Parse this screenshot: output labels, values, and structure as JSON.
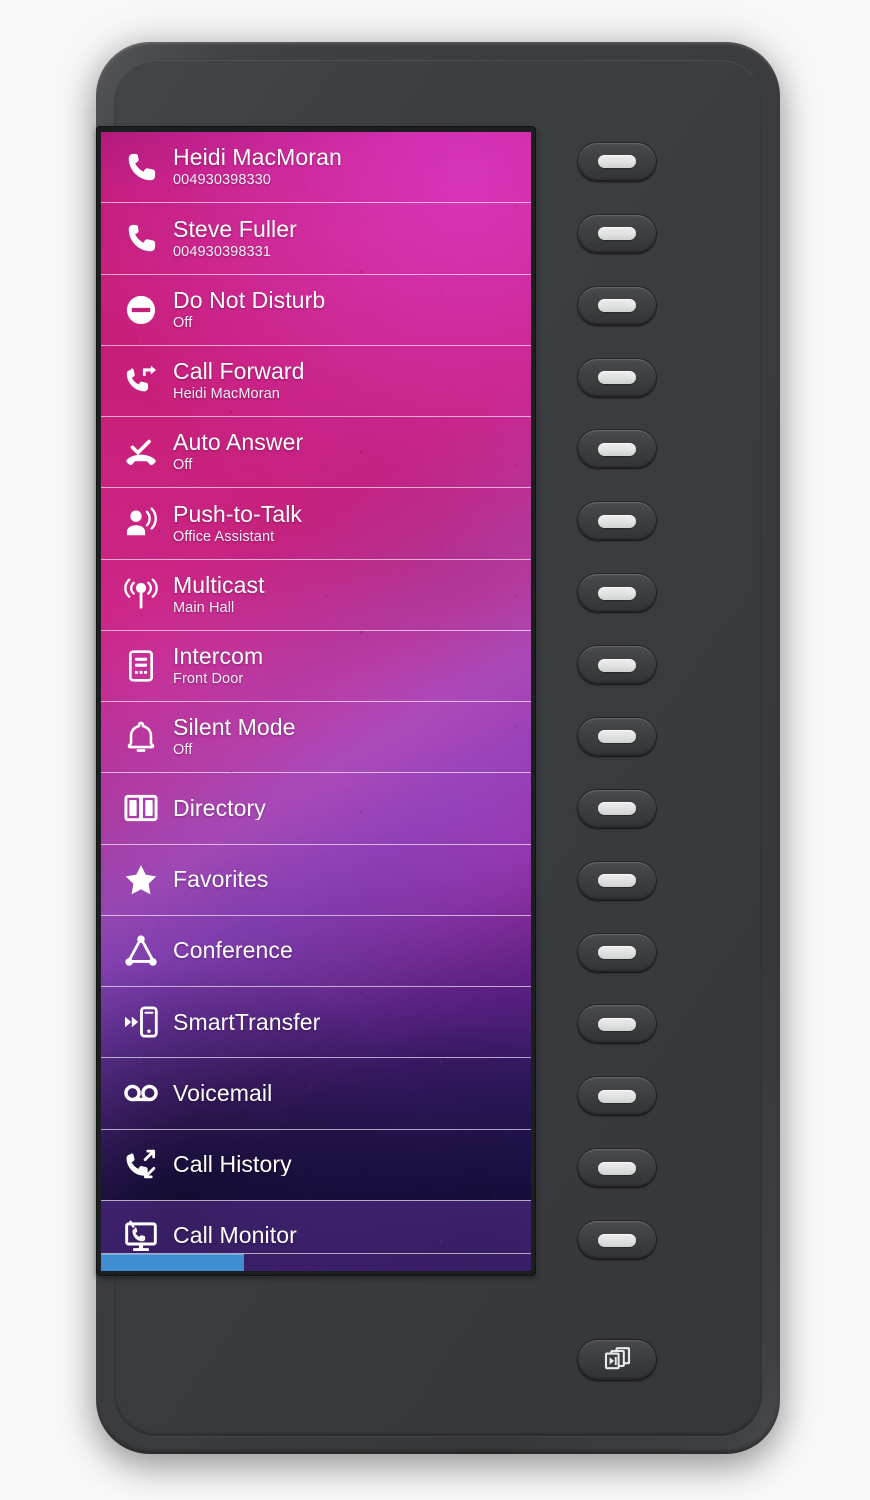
{
  "device": {
    "name": "expansion-module",
    "frame_color": "#3a3c3f",
    "screen_bg_top": "#c41e7e",
    "screen_bg_bottom": "#180f3c",
    "accent_color": "#3f8fd0"
  },
  "screen": {
    "items": [
      {
        "icon": "phone-icon",
        "title": "Heidi MacMoran",
        "subtitle": "004930398330"
      },
      {
        "icon": "phone-icon",
        "title": "Steve Fuller",
        "subtitle": "004930398331"
      },
      {
        "icon": "do-not-disturb-icon",
        "title": "Do Not Disturb",
        "subtitle": "Off"
      },
      {
        "icon": "call-forward-icon",
        "title": "Call Forward",
        "subtitle": "Heidi MacMoran"
      },
      {
        "icon": "auto-answer-icon",
        "title": "Auto Answer",
        "subtitle": "Off"
      },
      {
        "icon": "push-to-talk-icon",
        "title": "Push-to-Talk",
        "subtitle": "Office Assistant"
      },
      {
        "icon": "multicast-icon",
        "title": "Multicast",
        "subtitle": "Main Hall"
      },
      {
        "icon": "intercom-icon",
        "title": "Intercom",
        "subtitle": "Front Door"
      },
      {
        "icon": "silent-mode-icon",
        "title": "Silent Mode",
        "subtitle": "Off"
      },
      {
        "icon": "directory-icon",
        "title": "Directory",
        "subtitle": ""
      },
      {
        "icon": "favorites-icon",
        "title": "Favorites",
        "subtitle": ""
      },
      {
        "icon": "conference-icon",
        "title": "Conference",
        "subtitle": ""
      },
      {
        "icon": "smart-transfer-icon",
        "title": "SmartTransfer",
        "subtitle": ""
      },
      {
        "icon": "voicemail-icon",
        "title": "Voicemail",
        "subtitle": ""
      },
      {
        "icon": "call-history-icon",
        "title": "Call History",
        "subtitle": ""
      },
      {
        "icon": "call-monitor-icon",
        "title": "Call Monitor",
        "subtitle": ""
      }
    ],
    "page_indicator": {
      "pages": 3,
      "active_page": 1,
      "active_color": "#3f8fd0"
    }
  },
  "side_buttons": {
    "count": 16,
    "labels": [
      "Heidi MacMoran",
      "Steve Fuller",
      "Do Not Disturb",
      "Call Forward",
      "Auto Answer",
      "Push-to-Talk",
      "Multicast",
      "Intercom",
      "Silent Mode",
      "Directory",
      "Favorites",
      "Conference",
      "SmartTransfer",
      "Voicemail",
      "Call History",
      "Call Monitor"
    ]
  },
  "page_switch_button": {
    "icon": "page-switch-icon",
    "label": ""
  }
}
